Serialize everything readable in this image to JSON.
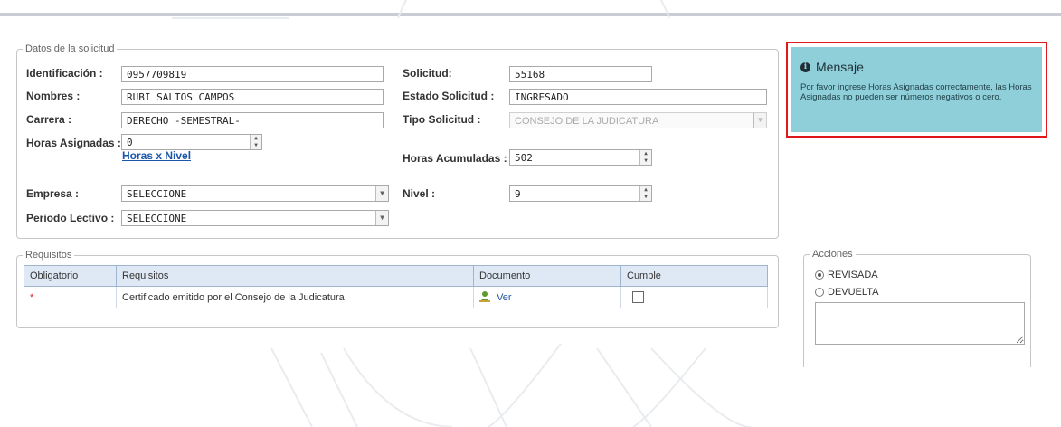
{
  "form": {
    "legend": "Datos de la solicitud",
    "identificacion_label": "Identificación :",
    "identificacion_value": "0957709819",
    "nombres_label": "Nombres :",
    "nombres_value": "RUBI SALTOS CAMPOS",
    "carrera_label": "Carrera :",
    "carrera_value": "DERECHO  -SEMESTRAL-",
    "horas_asignadas_label": "Horas Asignadas :",
    "horas_asignadas_value": "0",
    "horas_nivel_link": "Horas x Nivel",
    "empresa_label": "Empresa :",
    "empresa_value": "SELECCIONE",
    "periodo_label": "Periodo Lectivo :",
    "periodo_value": "SELECCIONE",
    "solicitud_label": "Solicitud:",
    "solicitud_value": "55168",
    "estado_label": "Estado Solicitud :",
    "estado_value": "INGRESADO",
    "tipo_label": "Tipo Solicitud :",
    "tipo_value": "CONSEJO DE LA JUDICATURA",
    "horas_acumuladas_label": "Horas Acumuladas :",
    "horas_acumuladas_value": "502",
    "nivel_label": "Nivel :",
    "nivel_value": "9"
  },
  "requisitos": {
    "legend": "Requisitos",
    "columns": [
      "Obligatorio",
      "Requisitos",
      "Documento",
      "Cumple"
    ],
    "rows": [
      {
        "obligatorio": "*",
        "requisito": "Certificado emitido por el Consejo de la Judicatura",
        "documento": "Ver",
        "cumple": false
      }
    ]
  },
  "mensaje": {
    "title": "Mensaje",
    "text": "Por favor ingrese Horas Asignadas correctamente, las Horas Asignadas no pueden ser números negativos o cero."
  },
  "acciones": {
    "legend": "Acciones",
    "options": [
      {
        "label": "REVISADA",
        "checked": true
      },
      {
        "label": "DEVUELTA",
        "checked": false
      }
    ],
    "comment_value": ""
  },
  "colors": {
    "message_bg": "#8ecfda",
    "highlight_border": "#e0181b",
    "link": "#1a55a8",
    "table_header": "#dfe9f5"
  }
}
